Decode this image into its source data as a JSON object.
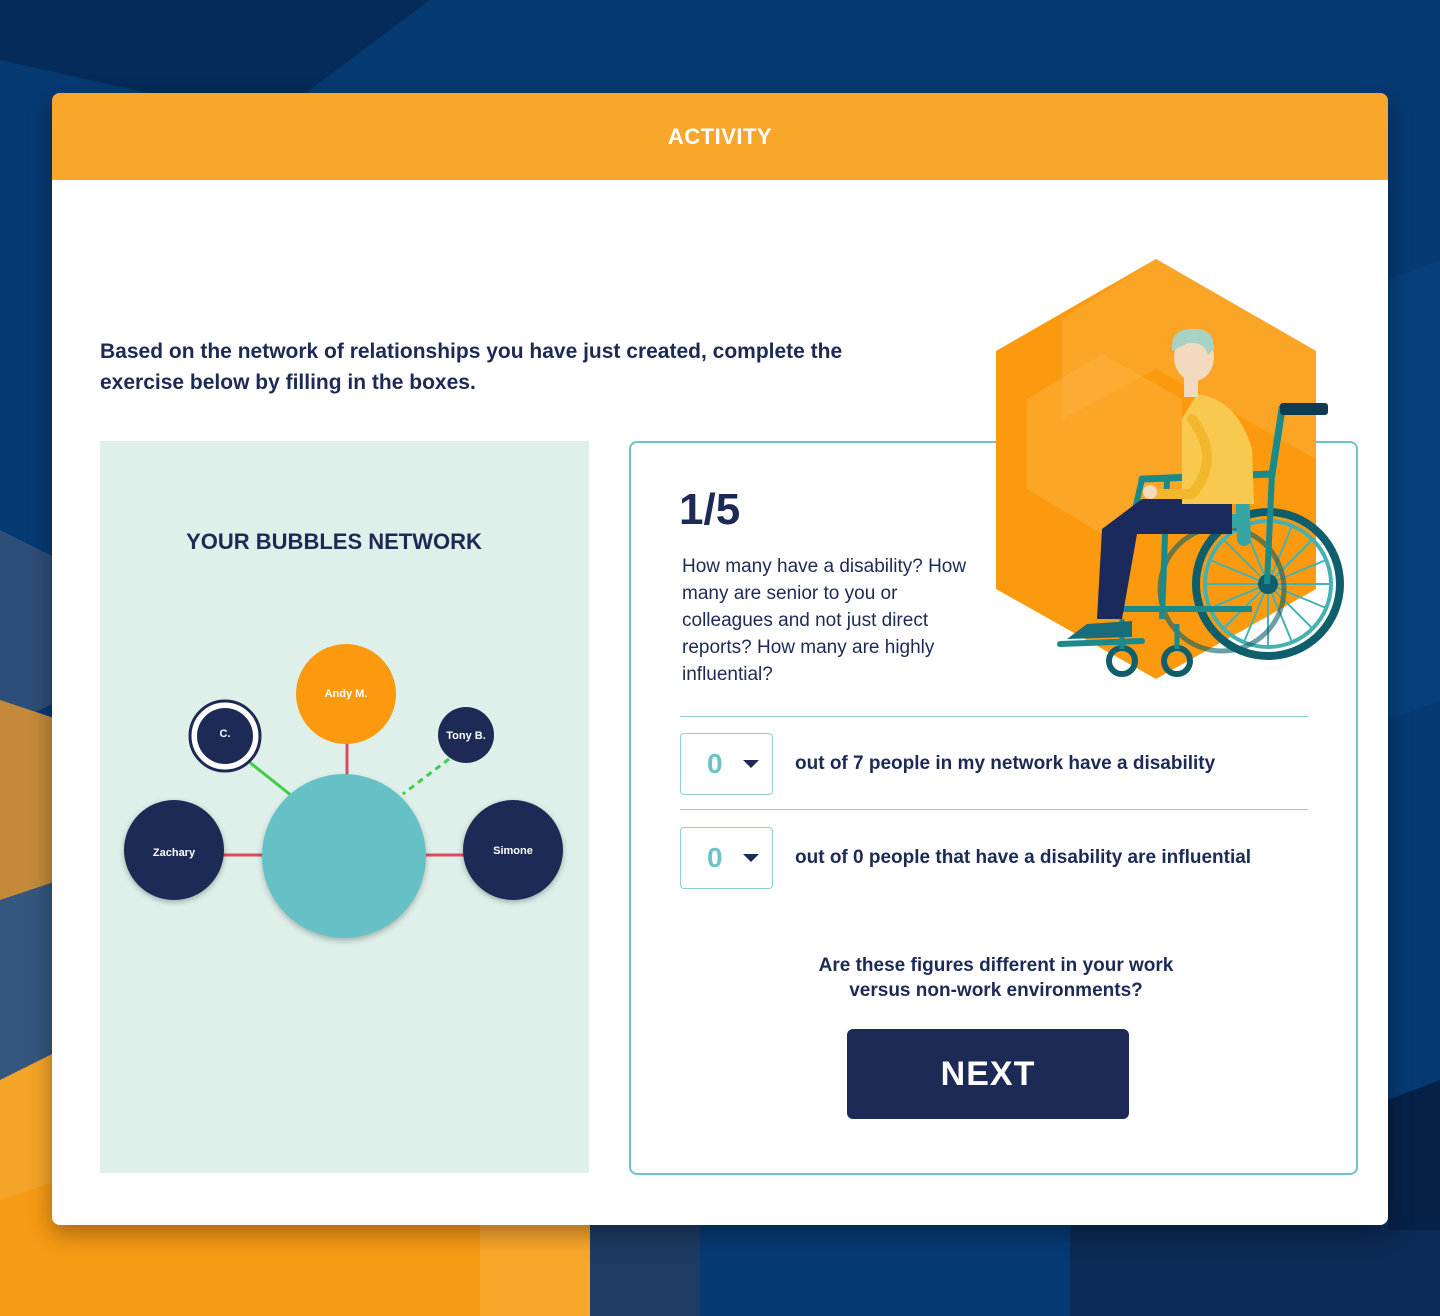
{
  "activity": {
    "header_title": "ACTIVITY",
    "intro": "Based on the network of relationships you have just created, complete the exercise below by filling in the boxes."
  },
  "network": {
    "title": "YOUR BUBBLES NETWORK",
    "nodes": [
      {
        "label": "Andy M.",
        "color": "#fb9a0e"
      },
      {
        "label": "C.",
        "color": "#1c2a55"
      },
      {
        "label": "Tony B.",
        "color": "#1c2a55"
      },
      {
        "label": "Zachary",
        "color": "#1c2a55"
      },
      {
        "label": "Simone",
        "color": "#1c2a55"
      }
    ],
    "center_color": "#65c1c6"
  },
  "question": {
    "step": "1/5",
    "text": "How many have a disability? How many are senior to you or colleagues and not just direct reports? How many are highly influential?",
    "rows": [
      {
        "value": "0",
        "text": "out of 7 people in my network have a disability"
      },
      {
        "value": "0",
        "text": "out of 0 people that have a disability are influential"
      }
    ],
    "followup": "Are these figures different in your work versus non-work environments?",
    "next_label": "NEXT"
  },
  "colors": {
    "brand_orange": "#f9a72b",
    "navy": "#1c2a55",
    "teal": "#6cc4c6",
    "panel_bg": "#dff0eb"
  },
  "icons": [
    "wheelchair-user-illustration",
    "caret-down-icon"
  ]
}
